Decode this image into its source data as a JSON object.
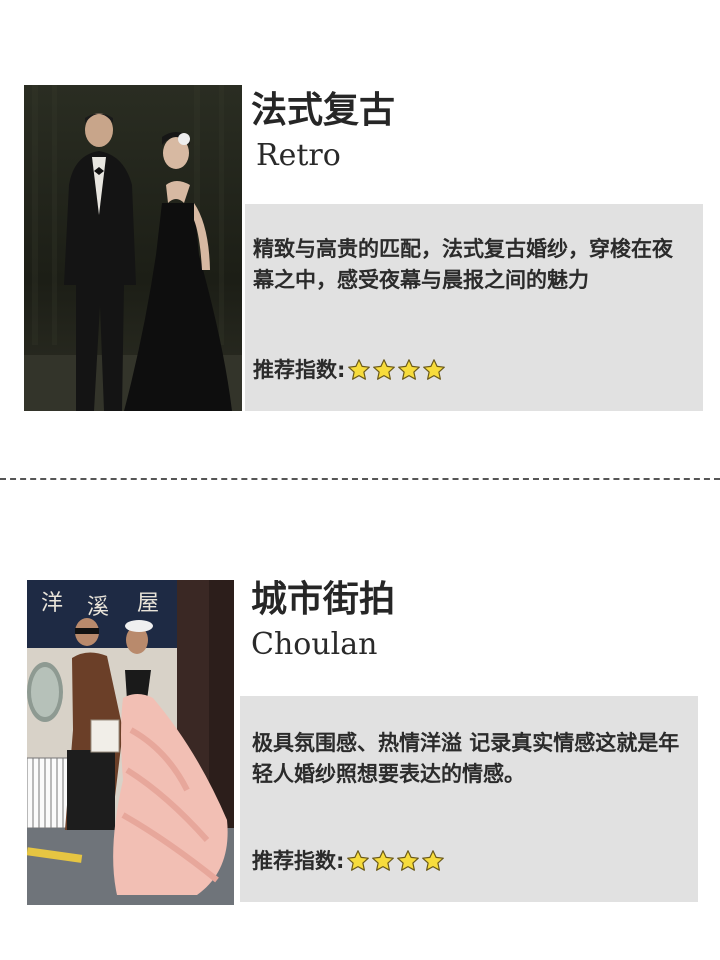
{
  "cards": [
    {
      "title_cn": "法式复古",
      "title_en": "Retro",
      "description": "精致与高贵的匹配，法式复古婚纱，穿梭在夜幕之中，感受夜幕与晨报之间的魅力",
      "rating_label": "推荐指数:",
      "rating_stars": 4,
      "photo_icon": "retro-couple-photo"
    },
    {
      "title_cn": "城市街拍",
      "title_en": "Choulan",
      "description": "极具氛围感、热情洋溢 记录真实情感这就是年轻人婚纱照想要表达的情感。",
      "rating_label": "推荐指数:",
      "rating_stars": 4,
      "photo_icon": "street-couple-photo"
    }
  ],
  "colors": {
    "box_bg": "#e1e1e1",
    "star_fill": "#f7dc3c",
    "star_stroke": "#6b5a1a",
    "divider": "#555555"
  }
}
